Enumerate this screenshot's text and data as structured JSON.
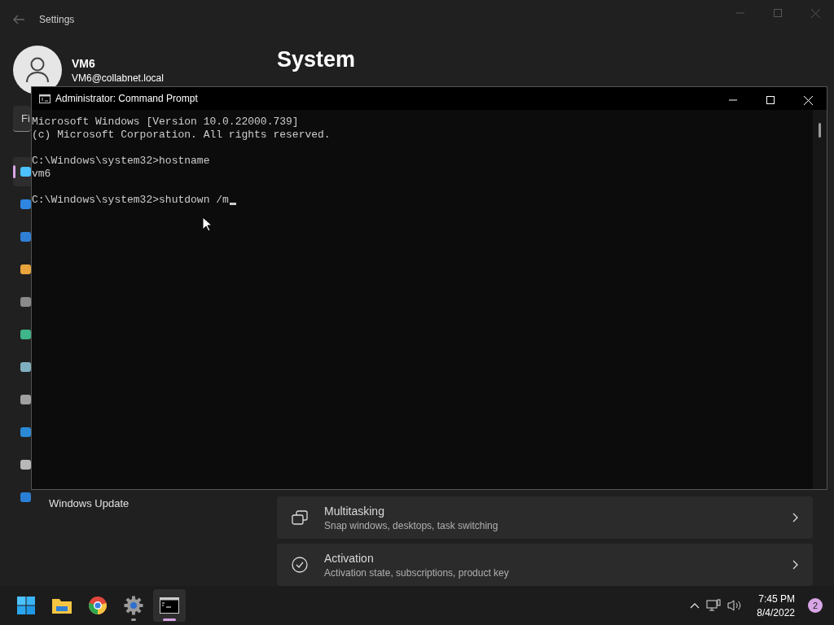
{
  "settings_window": {
    "title": "Settings",
    "active": false,
    "account": {
      "name": "VM6",
      "email": "VM6@collabnet.local"
    },
    "search": {
      "placeholder": "Fi"
    },
    "sidebar": {
      "items": [
        {
          "selected": true,
          "color": "#4cc2ff"
        },
        {
          "selected": false,
          "color": "#2f86e0"
        },
        {
          "selected": false,
          "color": "#2f7fd6"
        },
        {
          "selected": false,
          "color": "#e8a33d"
        },
        {
          "selected": false,
          "color": "#8a8a8a"
        },
        {
          "selected": false,
          "color": "#3fb58a"
        },
        {
          "selected": false,
          "color": "#7fb0c0"
        },
        {
          "selected": false,
          "color": "#a0a0a0"
        },
        {
          "selected": false,
          "color": "#2a8ad6"
        },
        {
          "selected": false,
          "color": "#b8b8b8"
        },
        {
          "selected": false,
          "color": "#2b7fd4",
          "label": "Windows Update"
        }
      ]
    },
    "page_title": "System",
    "cards": [
      {
        "kind": "multitasking",
        "title": "Multitasking",
        "subtitle": "Snap windows, desktops, task switching"
      },
      {
        "kind": "activation",
        "title": "Activation",
        "subtitle": "Activation state, subscriptions, product key"
      }
    ]
  },
  "console_window": {
    "title": "Administrator: Command Prompt",
    "blocks": [
      [
        "Microsoft Windows [Version 10.0.22000.739]",
        "(c) Microsoft Corporation. All rights reserved."
      ],
      [
        "C:\\Windows\\system32>hostname",
        "vm6"
      ],
      [
        "C:\\Windows\\system32>shutdown /m"
      ]
    ]
  },
  "taskbar": {
    "apps": [
      {
        "kind": "start",
        "running": false,
        "selected": false
      },
      {
        "kind": "explorer",
        "running": false,
        "selected": false
      },
      {
        "kind": "browser",
        "running": false,
        "selected": false
      },
      {
        "kind": "settings",
        "running": true,
        "selected": false
      },
      {
        "kind": "terminal",
        "running": true,
        "selected": true
      }
    ],
    "time": "7:45 PM",
    "date": "8/4/2022",
    "notifications": "2"
  }
}
